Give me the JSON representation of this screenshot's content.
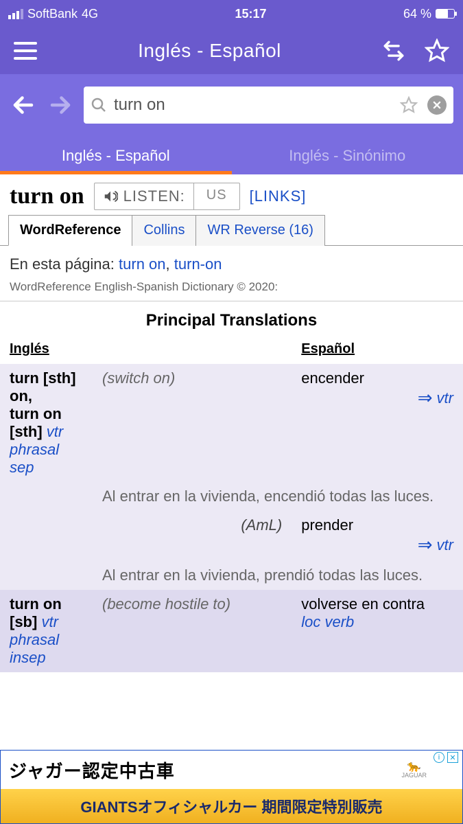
{
  "status": {
    "carrier": "SoftBank",
    "network": "4G",
    "time": "15:17",
    "battery": "64 %"
  },
  "appbar": {
    "title": "Inglés - Español"
  },
  "search": {
    "value": "turn on"
  },
  "dict_tabs": {
    "active": "Inglés - Español",
    "inactive": "Inglés - Sinónimo"
  },
  "entry": {
    "headword": "turn on",
    "listen_label": "LISTEN:",
    "accent": "US",
    "links_label": "[LINKS]"
  },
  "source_tabs": [
    "WordReference",
    "Collins",
    "WR Reverse (16)"
  ],
  "on_page": {
    "label": "En esta página:",
    "links": [
      "turn on",
      "turn-on"
    ]
  },
  "copyright": "WordReference English-Spanish Dictionary © 2020:",
  "section_title": "Principal Translations",
  "columns": {
    "en": "Inglés",
    "es": "Español"
  },
  "rows": [
    {
      "en_main": "turn [sth] on,",
      "en_sub": "turn on [sth]",
      "pos": "vtr phrasal sep",
      "def": "(switch on)",
      "es": "encender",
      "conj": "vtr"
    }
  ],
  "example1": "Al entrar en la vivienda, encendió todas las luces.",
  "alt": {
    "region": "(AmL)",
    "es": "prender",
    "conj": "vtr"
  },
  "example2": "Al entrar en la vivienda, prendió todas las luces.",
  "row2": {
    "en_main": "turn on [sb]",
    "pos": "vtr phrasal insep",
    "def": "(become hostile to)",
    "es": "volverse en contra",
    "es_pos": "loc verb"
  },
  "ad": {
    "line1": "ジャガー認定中古車",
    "brand": "JAGUAR",
    "line2": "GIANTSオフィシャルカー 期間限定特別販売"
  }
}
